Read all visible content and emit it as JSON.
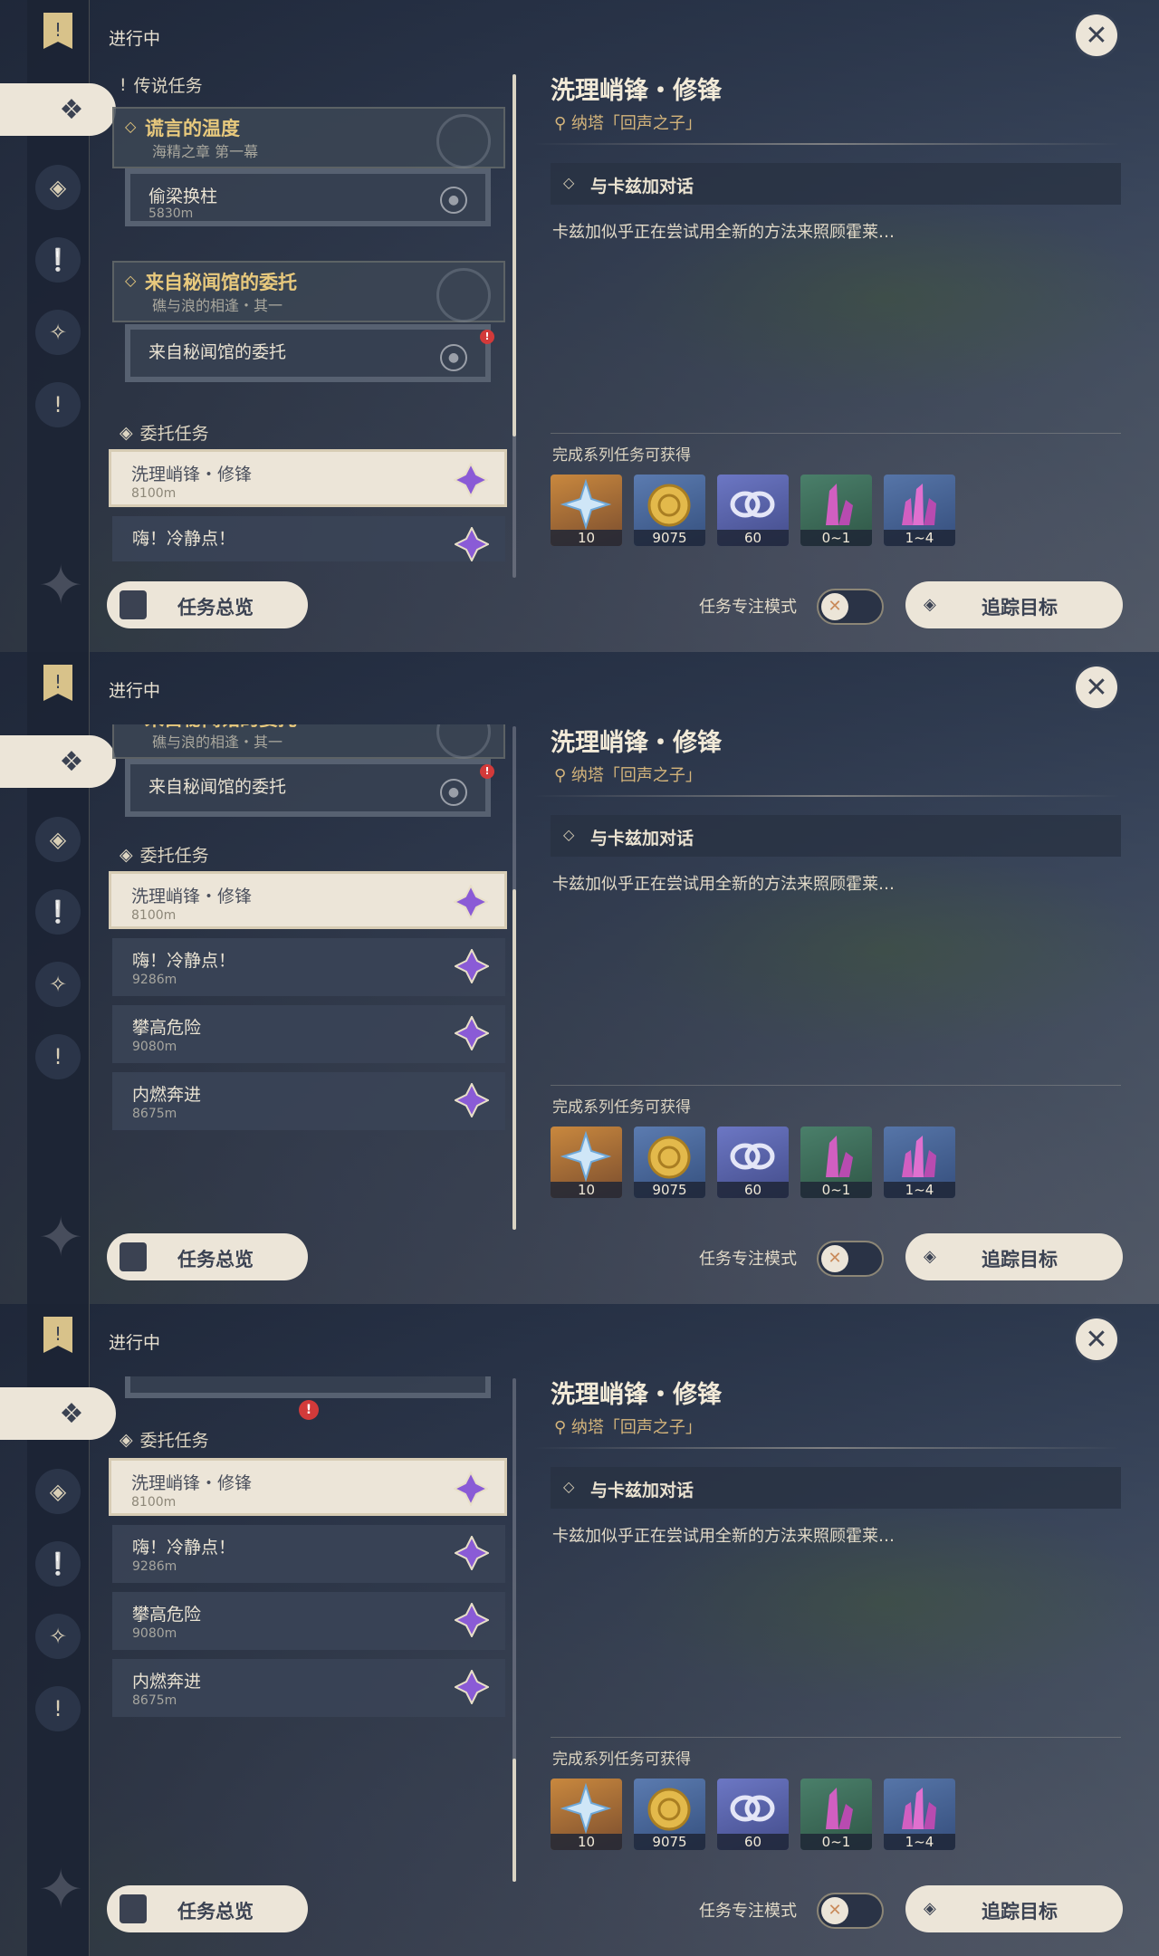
{
  "shared": {
    "ongoing": "进行中",
    "legend_section": "传说任务",
    "commission_section": "委托任务",
    "legend_quests": [
      {
        "title": "谎言的温度",
        "subtitle": "海精之章 第一幕"
      },
      {
        "title": "来自秘闻馆的委托",
        "subtitle": "礁与浪的相逢・其一"
      }
    ],
    "sub_quests": [
      {
        "title": "偷梁换柱",
        "distance": "5830m"
      },
      {
        "title": "来自秘闻馆的委托",
        "distance": ""
      }
    ],
    "commissions": [
      {
        "title": "洗理峭锋・修锋",
        "distance": "8100m"
      },
      {
        "title": "嗨！冷静点！",
        "distance": "9286m"
      },
      {
        "title": "攀高危险",
        "distance": "9080m"
      },
      {
        "title": "内燃奔进",
        "distance": "8675m"
      }
    ],
    "detail": {
      "title": "洗理峭锋・修锋",
      "location": "纳塔「回声之子」",
      "step": "与卡兹加对话",
      "description": "卡兹加似乎正在尝试用全新的方法来照顾霍莱…",
      "reward_heading": "完成系列任务可获得",
      "rewards": [
        {
          "name": "primogem",
          "amount": "10"
        },
        {
          "name": "mora",
          "amount": "9075"
        },
        {
          "name": "adventure-exp",
          "amount": "60"
        },
        {
          "name": "crystal-chunk",
          "amount": "0~1"
        },
        {
          "name": "crystal-cluster",
          "amount": "1~4"
        }
      ]
    },
    "overview_label": "任务总览",
    "focus_mode_label": "任务专注模式",
    "track_label": "追踪目标",
    "colors": {
      "accent": "#e8c97d",
      "panel_light": "#ece5d8",
      "gem": "#8a5bd6"
    }
  }
}
